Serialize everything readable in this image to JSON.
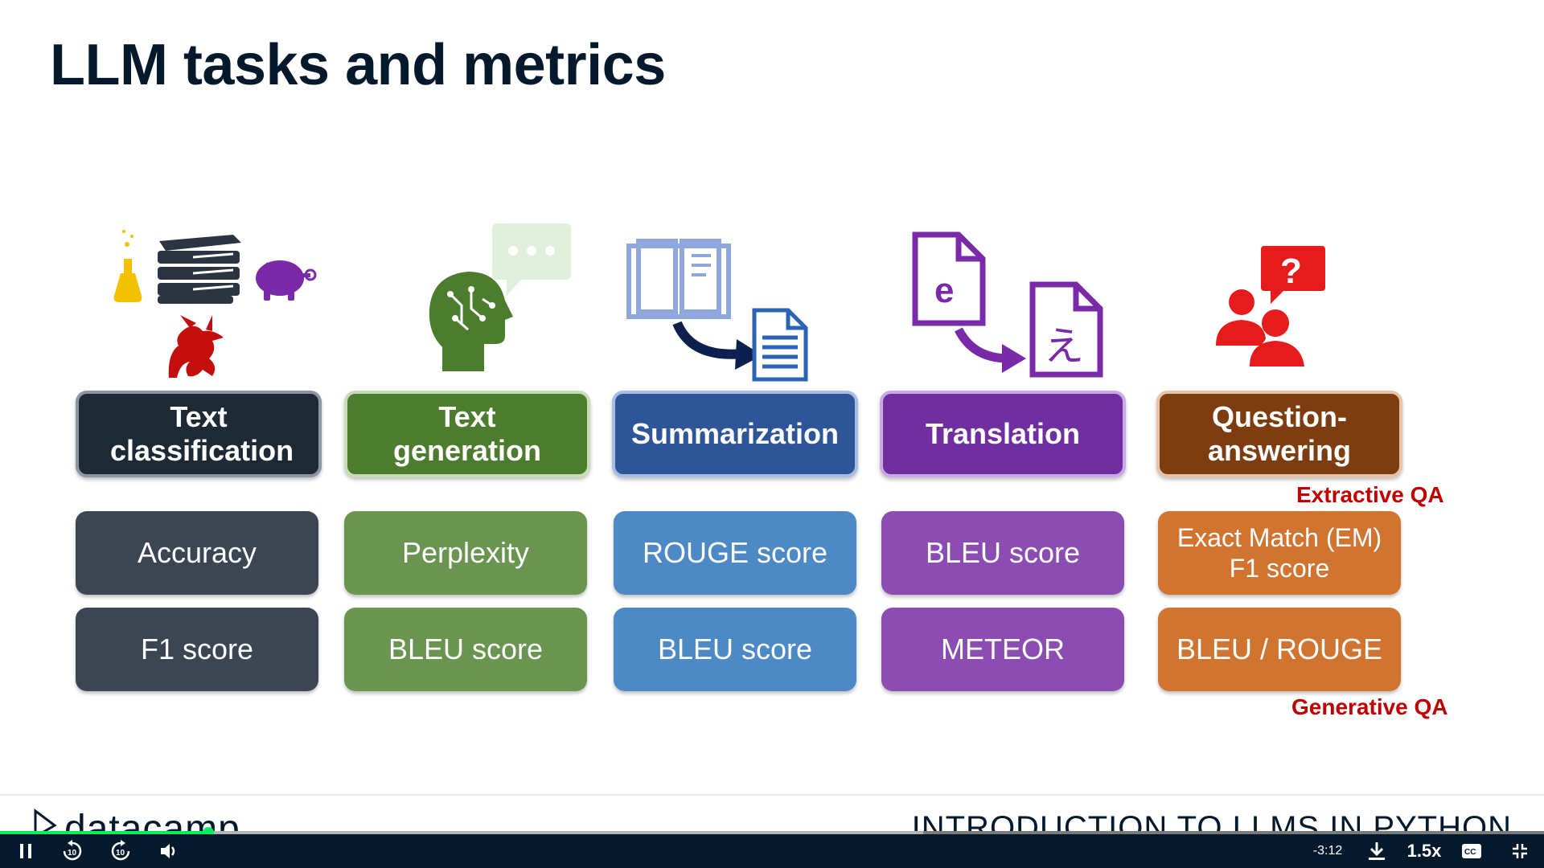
{
  "slide": {
    "title": "LLM tasks and metrics",
    "columns": [
      {
        "task": "Text classification",
        "color": "#1e2936",
        "border": "#8b95a3",
        "metric_color": "#3c4653",
        "metrics": [
          "Accuracy",
          "F1 score"
        ]
      },
      {
        "task": "Text generation",
        "color": "#4c7c2e",
        "border": "#c9dcb8",
        "metric_color": "#6a9550",
        "metrics": [
          "Perplexity",
          "BLEU score"
        ]
      },
      {
        "task": "Summarization",
        "color": "#2e5597",
        "border": "#a7bde3",
        "metric_color": "#4d89c4",
        "metrics": [
          "ROUGE score",
          "BLEU score"
        ]
      },
      {
        "task": "Translation",
        "color": "#6f2fa0",
        "border": "#c9a9e6",
        "metric_color": "#8b4db1",
        "metrics": [
          "BLEU score",
          "METEOR"
        ]
      },
      {
        "task": "Question-answering",
        "color": "#7d3d10",
        "border": "#e6c3a6",
        "metric_color": "#d07430",
        "metrics": [
          "Exact Match (EM)\nF1 score",
          "BLEU / ROUGE"
        ]
      }
    ],
    "qa_notes": {
      "extractive": "Extractive QA",
      "generative": "Generative QA"
    },
    "footer": {
      "brand": "datacamp",
      "course": "INTRODUCTION TO LLMS IN PYTHON"
    }
  },
  "player": {
    "time_remaining": "-3:12",
    "speed": "1.5x",
    "icons": [
      "pause-icon",
      "rewind-10-icon",
      "forward-10-icon",
      "volume-icon",
      "download-icon",
      "captions-icon",
      "exit-fullscreen-icon"
    ],
    "progress": 0.135,
    "buffered": 0.598,
    "accent": "#03ef62"
  }
}
